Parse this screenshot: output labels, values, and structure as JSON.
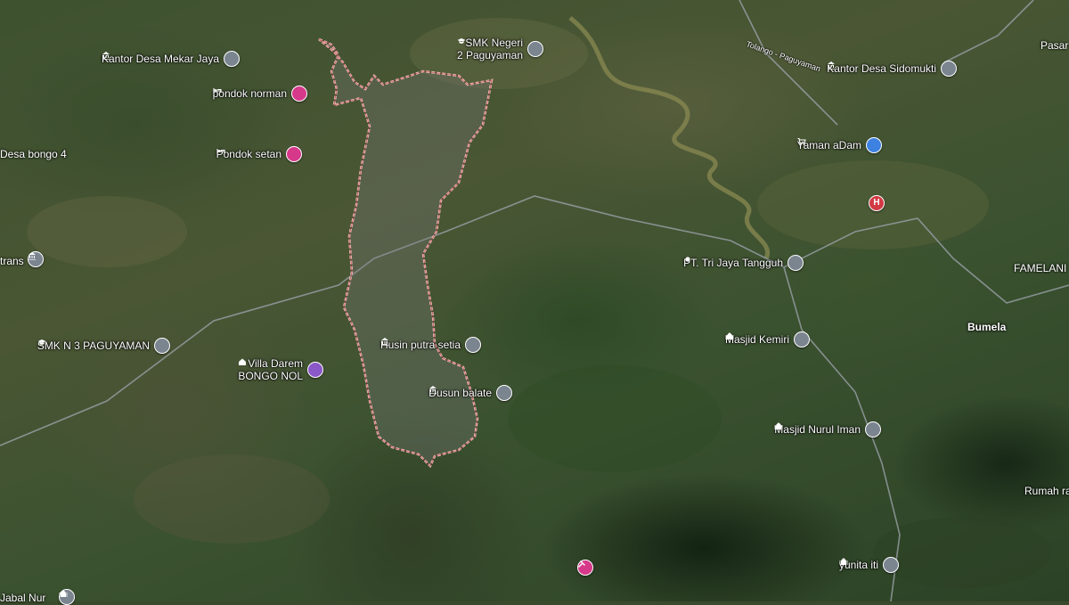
{
  "map": {
    "type": "satellite",
    "boundary_color": "#f2b9b9",
    "road_label": "Tolango - Paguyaman",
    "places": {
      "bumela": "Bumela",
      "famelani": "FAMELANI",
      "pasar": "Pasar",
      "rumah": "Rumah ra",
      "desa_bongo": "Desa bongo 4",
      "trans": "trans",
      "jabal_nur": "Jabal Nur"
    },
    "pois": {
      "kantor_mekar_jaya": {
        "label": "Kantor Desa Mekar Jaya",
        "icon": "government-icon"
      },
      "pondok_norman": {
        "label": "pondok norman",
        "icon": "hotel-icon"
      },
      "pondok_setan": {
        "label": "Pondok setan",
        "icon": "hotel-icon"
      },
      "smk_negeri_2": {
        "line1": "SMK Negeri",
        "line2": "2 Paguyaman",
        "icon": "school-icon"
      },
      "kantor_sidomukti": {
        "label": "Kantor Desa Sidomukti",
        "icon": "government-icon"
      },
      "yaman_adam": {
        "label": "Yaman aDam",
        "icon": "shopping-icon"
      },
      "hospital": {
        "label": "",
        "icon": "hospital-icon"
      },
      "pt_tri_jaya": {
        "label": "PT. Tri Jaya Tangguh",
        "icon": "location-dot-icon"
      },
      "smk_n_3": {
        "label": "SMK N 3 PAGUYAMAN",
        "icon": "school-icon"
      },
      "villa_darem": {
        "line1": "Villa Darem",
        "line2": "BONGO NOL",
        "icon": "lodging-icon"
      },
      "husin_putra_setia": {
        "label": "Husin putra setia",
        "icon": "government-icon"
      },
      "dusun_balate": {
        "label": "Dusun balate",
        "icon": "government-icon"
      },
      "masjid_kemiri": {
        "label": "Masjid Kemiri",
        "icon": "mosque-icon"
      },
      "masjid_nurul_iman": {
        "label": "Masjid Nurul Iman",
        "icon": "mosque-icon"
      },
      "yunita_iti": {
        "label": "yunita iti",
        "icon": "mosque-icon"
      },
      "tools_shop": {
        "label": "",
        "icon": "tools-icon"
      },
      "trans_marker": {
        "label": "",
        "icon": "government-icon"
      },
      "jabal_marker": {
        "label": "",
        "icon": "mosque-icon"
      }
    }
  }
}
